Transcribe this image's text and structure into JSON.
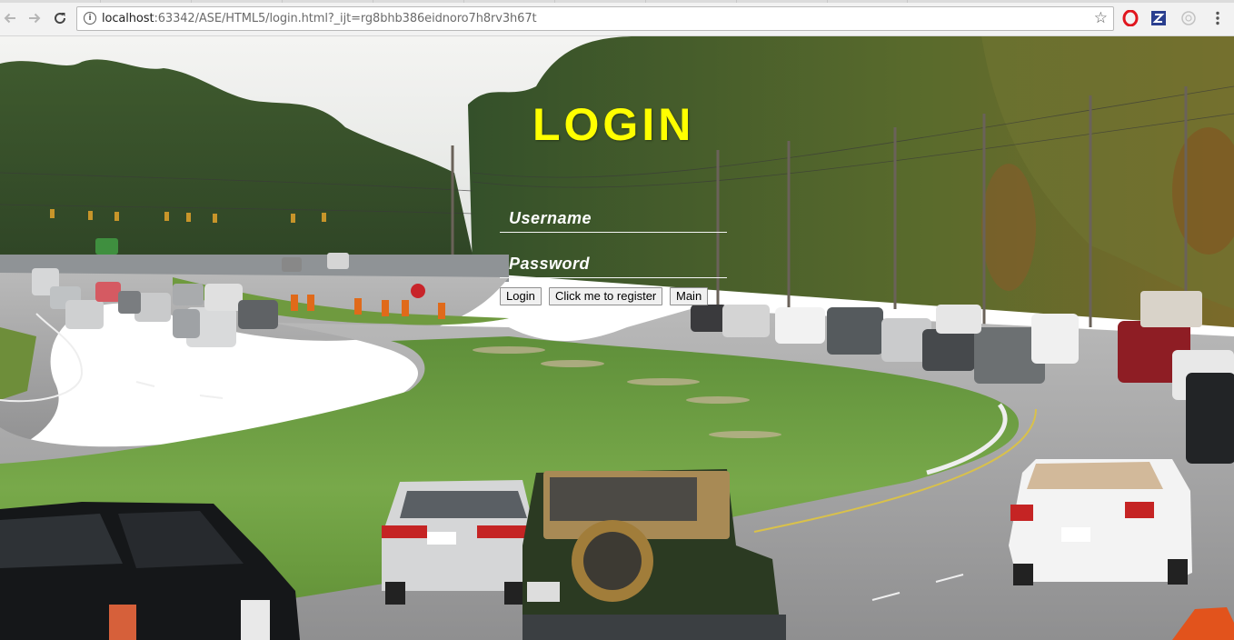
{
  "browser": {
    "url_host": "localhost",
    "url_rest": ":63342/ASE/HTML5/login.html?_ijt=rg8bhb386eidnoro7h8rv3h67t",
    "icons": [
      "back-arrow-icon",
      "forward-arrow-icon",
      "reload-icon",
      "info-icon",
      "star-icon",
      "opera-extension-icon",
      "zotero-extension-icon",
      "extension-icon",
      "menu-icon"
    ]
  },
  "login": {
    "title": "LOGIN",
    "username_placeholder": "Username",
    "password_placeholder": "Password",
    "login_button": "Login",
    "register_button": "Click me to register",
    "main_button": "Main",
    "title_color": "#ffff00"
  }
}
